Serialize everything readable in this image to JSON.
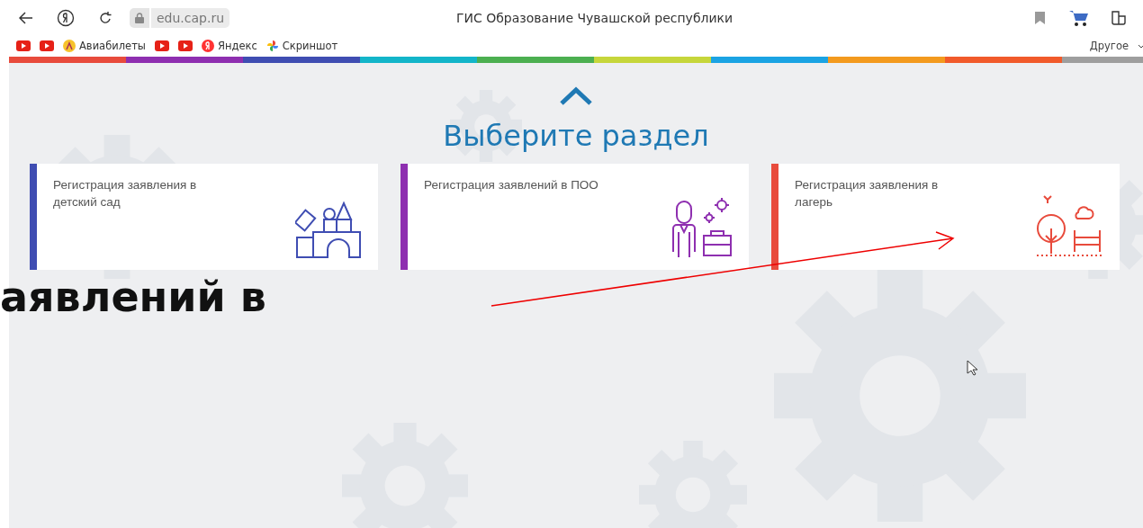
{
  "browser": {
    "address": "edu.cap.ru",
    "title": "ГИС Образование Чувашской республики",
    "bookmarks": [
      {
        "kind": "youtube"
      },
      {
        "kind": "youtube"
      },
      {
        "kind": "avia",
        "label": "Авиабилеты"
      },
      {
        "kind": "youtube"
      },
      {
        "kind": "youtube"
      },
      {
        "kind": "yandex",
        "label": "Яндекс"
      },
      {
        "kind": "pinwheel",
        "label": "Скриншот"
      }
    ],
    "other_bookmarks": "Другое"
  },
  "stripe": [
    {
      "color": "#e84b3c"
    },
    {
      "color": "#8e2fb0"
    },
    {
      "color": "#3f4db2"
    },
    {
      "color": "#13b5c9"
    },
    {
      "color": "#4caf50"
    },
    {
      "color": "#c6d63b"
    },
    {
      "color": "#1ba3e3"
    },
    {
      "color": "#f39a1e"
    },
    {
      "color": "#f15a2b"
    },
    {
      "color": "#9e9e9e"
    }
  ],
  "heading": "Выберите раздел",
  "cards": [
    {
      "title": "Регистрация заявления в детский сад",
      "color": "#3f4db2",
      "kind": "blocks"
    },
    {
      "title": "Регистрация заявлений в ПОО",
      "color": "#8e2fb0",
      "kind": "worker"
    },
    {
      "title": "Регистрация заявления в лагерь",
      "color": "#e84b3c",
      "kind": "camp"
    }
  ],
  "overlay_text": "аявлений в"
}
